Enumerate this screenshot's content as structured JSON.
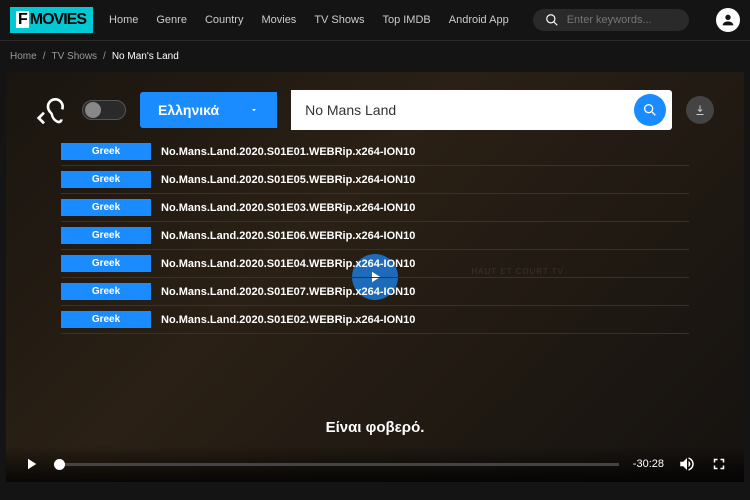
{
  "header": {
    "logo_prefix": "F",
    "logo_text": "MOVIES",
    "nav": [
      "Home",
      "Genre",
      "Country",
      "Movies",
      "TV Shows",
      "Top IMDB",
      "Android App"
    ],
    "search_placeholder": "Enter keywords..."
  },
  "breadcrumb": {
    "items": [
      "Home",
      "TV Shows"
    ],
    "current": "No Man's Land"
  },
  "subtitle_panel": {
    "language_selected": "Ελληνικά",
    "search_value": "No Mans Land",
    "results": [
      {
        "lang": "Greek",
        "title": "No.Mans.Land.2020.S01E01.WEBRip.x264-ION10"
      },
      {
        "lang": "Greek",
        "title": "No.Mans.Land.2020.S01E05.WEBRip.x264-ION10"
      },
      {
        "lang": "Greek",
        "title": "No.Mans.Land.2020.S01E03.WEBRip.x264-ION10"
      },
      {
        "lang": "Greek",
        "title": "No.Mans.Land.2020.S01E06.WEBRip.x264-ION10"
      },
      {
        "lang": "Greek",
        "title": "No.Mans.Land.2020.S01E04.WEBRip.x264-ION10"
      },
      {
        "lang": "Greek",
        "title": "No.Mans.Land.2020.S01E07.WEBRip.x264-ION10"
      },
      {
        "lang": "Greek",
        "title": "No.Mans.Land.2020.S01E02.WEBRip.x264-ION10"
      }
    ]
  },
  "player": {
    "subtitle_text": "Είναι φοβερό.",
    "time_remaining": "-30:28",
    "watermark": "HAUT ET COURT TV"
  }
}
